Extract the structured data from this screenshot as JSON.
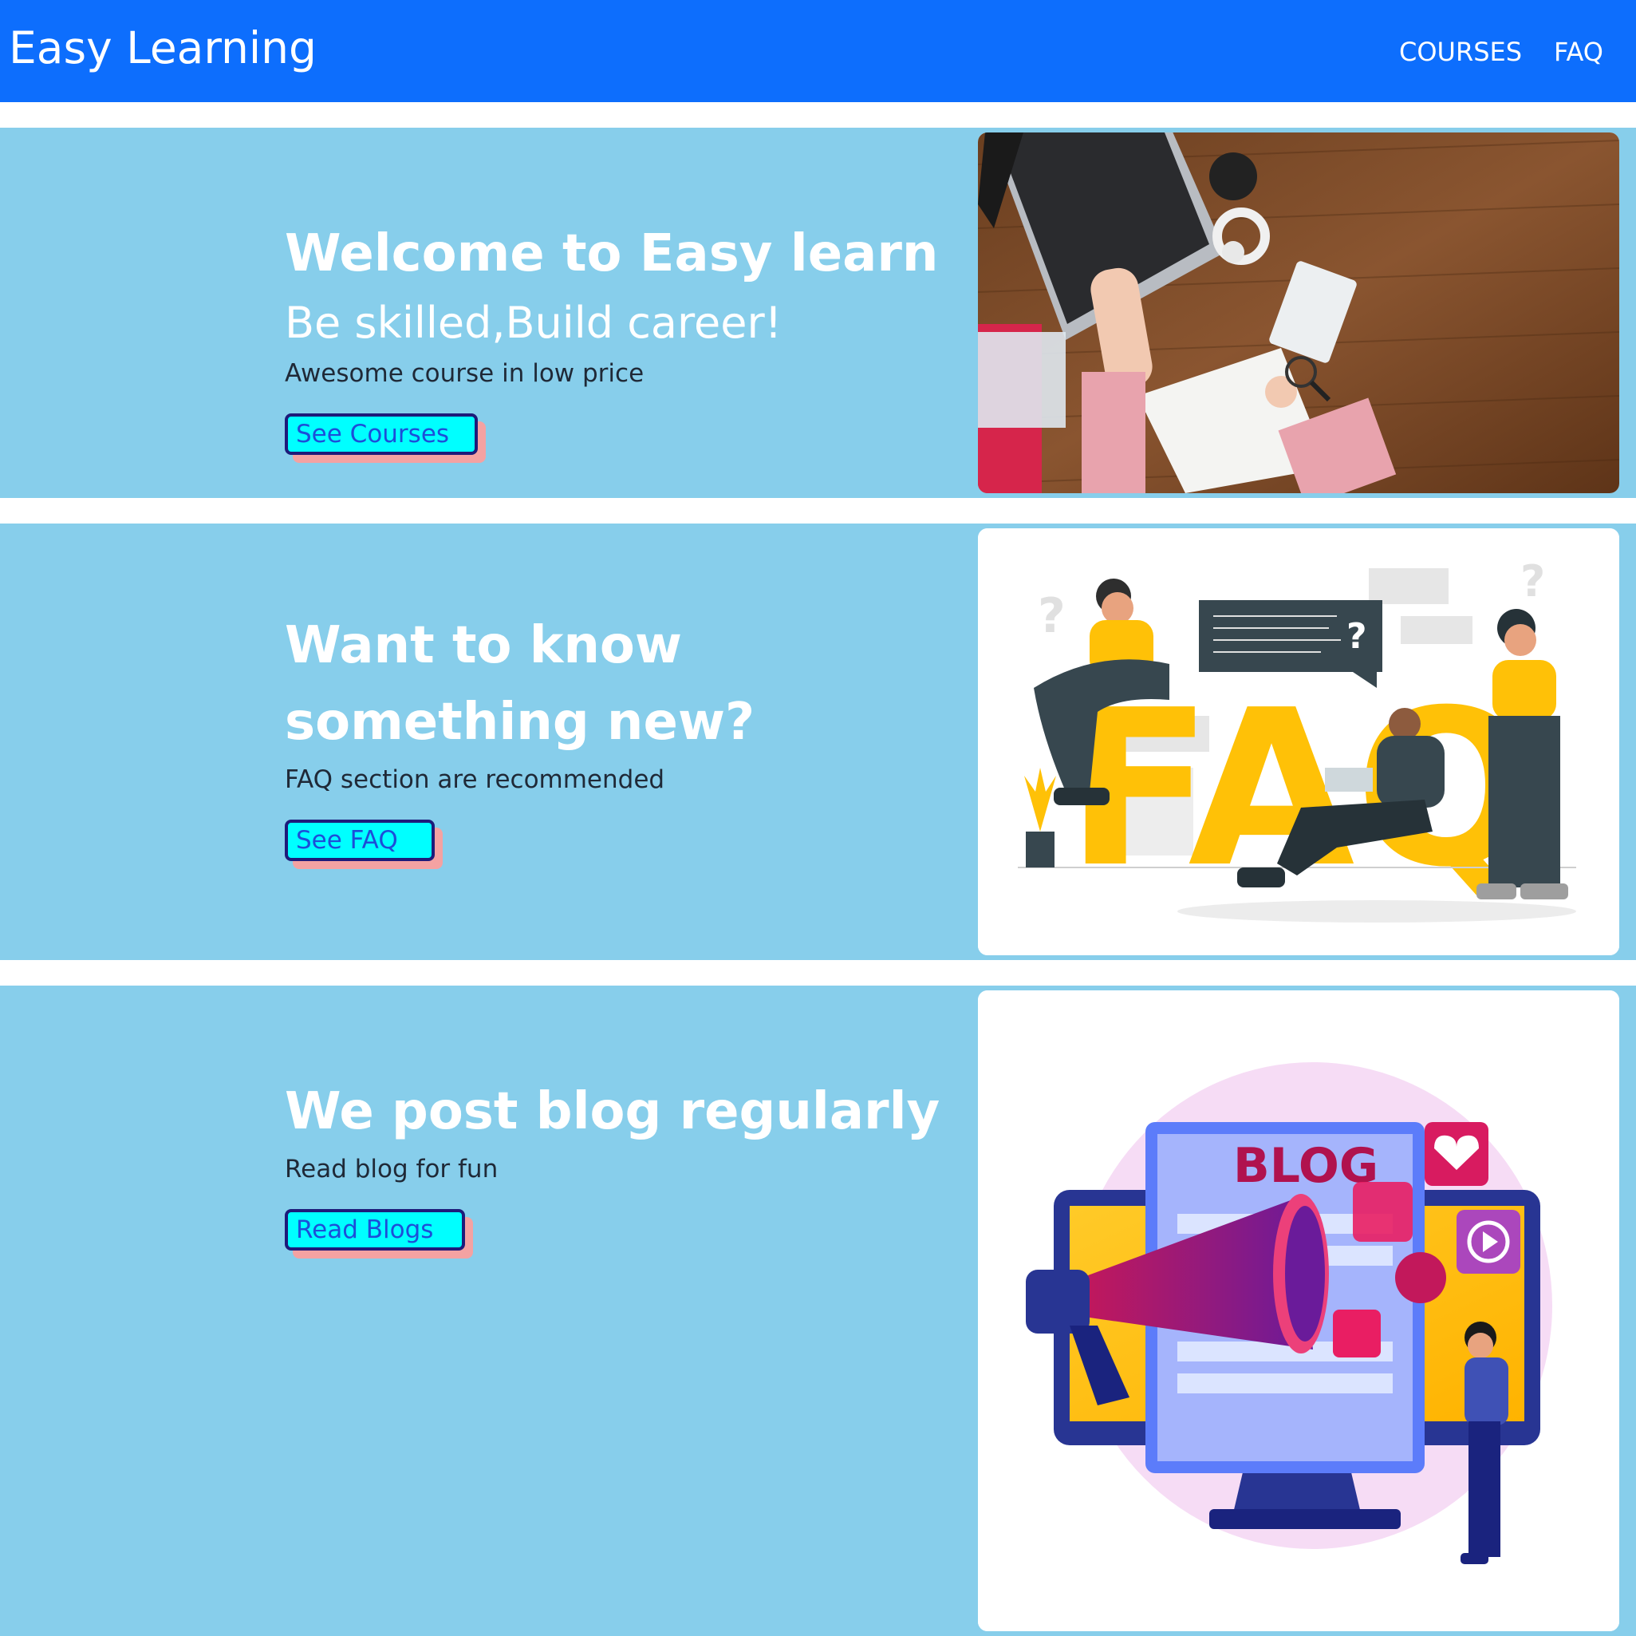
{
  "navbar": {
    "brand": "Easy Learning",
    "links": [
      "COURSES",
      "FAQ"
    ],
    "bg_color": "#0d6efd"
  },
  "sections": [
    {
      "title": "Welcome to Easy learn",
      "subtitle": "Be skilled,Build career!",
      "text": "Awesome course in low price",
      "button": "See Courses",
      "image": "desk-workspace-photo"
    },
    {
      "title": "Want to know something new?",
      "text": "FAQ section are recommended",
      "button": "See FAQ",
      "image": "faq-illustration",
      "image_text": [
        "FAQ",
        "?"
      ]
    },
    {
      "title": "We post blog regularly",
      "text": "Read blog for fun",
      "button": "Read Blogs",
      "image": "blog-megaphone-illustration",
      "image_text": [
        "BLOG"
      ]
    }
  ],
  "colors": {
    "section_bg": "#87ceeb",
    "button_bg": "#00ffff",
    "button_border": "#1e1b7a",
    "button_shadow": "#f4a2a2"
  }
}
